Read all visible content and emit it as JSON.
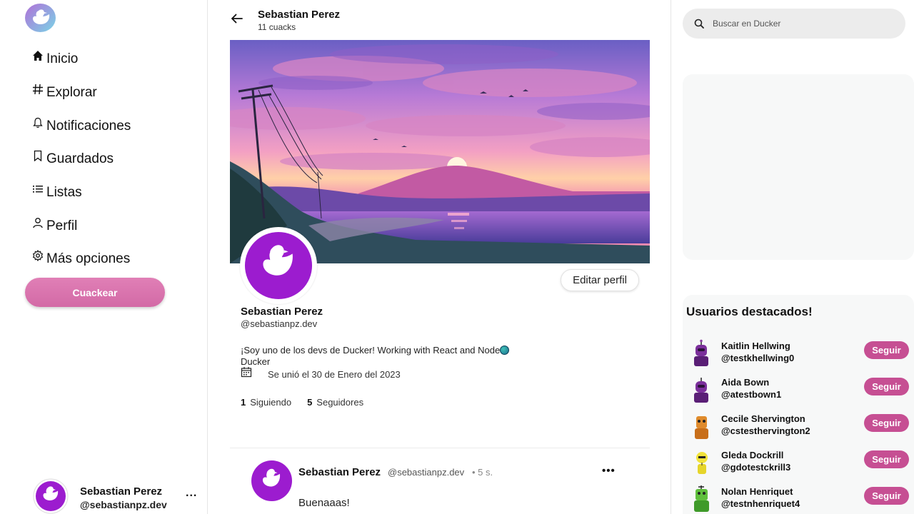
{
  "sidebar": {
    "logo": "duck-logo",
    "nav": [
      {
        "icon": "home-icon",
        "label": "Inicio"
      },
      {
        "icon": "hashtag-icon",
        "label": "Explorar"
      },
      {
        "icon": "bell-icon",
        "label": "Notificaciones"
      },
      {
        "icon": "bookmark-icon",
        "label": "Guardados"
      },
      {
        "icon": "list-icon",
        "label": "Listas"
      },
      {
        "icon": "person-icon",
        "label": "Perfil"
      },
      {
        "icon": "gear-icon",
        "label": "Más opciones"
      }
    ],
    "cta_label": "Cuackear",
    "account": {
      "name": "Sebastian Perez",
      "handle": "@sebastianpz.dev",
      "more": "..."
    }
  },
  "header": {
    "name": "Sebastian Perez",
    "count": "11 cuacks"
  },
  "profile": {
    "edit_label": "Editar perfil",
    "name": "Sebastian Perez",
    "handle": "@sebastianpz.dev",
    "bio_line1": "¡Soy uno de los devs de Ducker! Working with React and Node",
    "bio_line2": "Ducker",
    "joined": "Se unió el 30 de Enero del 2023",
    "following_count": "1",
    "following_label": "Siguiendo",
    "followers_count": "5",
    "followers_label": "Seguidores"
  },
  "post": {
    "name": "Sebastian Perez",
    "handle": "@sebastianpz.dev",
    "time": "• 5 s.",
    "more": "•••",
    "text": "Buenaaas!"
  },
  "search": {
    "placeholder": "Buscar en Ducker"
  },
  "featured": {
    "title": "Usuarios destacados!",
    "follow_label": "Seguir",
    "users": [
      {
        "name": "Kaitlin Hellwing",
        "handle": "@testkhellwing0"
      },
      {
        "name": "Aida Bown",
        "handle": "@atestbown1"
      },
      {
        "name": "Cecile Shervington",
        "handle": "@cstesthervington2"
      },
      {
        "name": "Gleda Dockrill",
        "handle": "@gdotestckrill3"
      },
      {
        "name": "Nolan Henriquet",
        "handle": "@testnhenriquet4"
      }
    ]
  },
  "colors": {
    "accent": "#c64f93",
    "brand_purple": "#9c1ccf",
    "cta": "#d86fab"
  }
}
